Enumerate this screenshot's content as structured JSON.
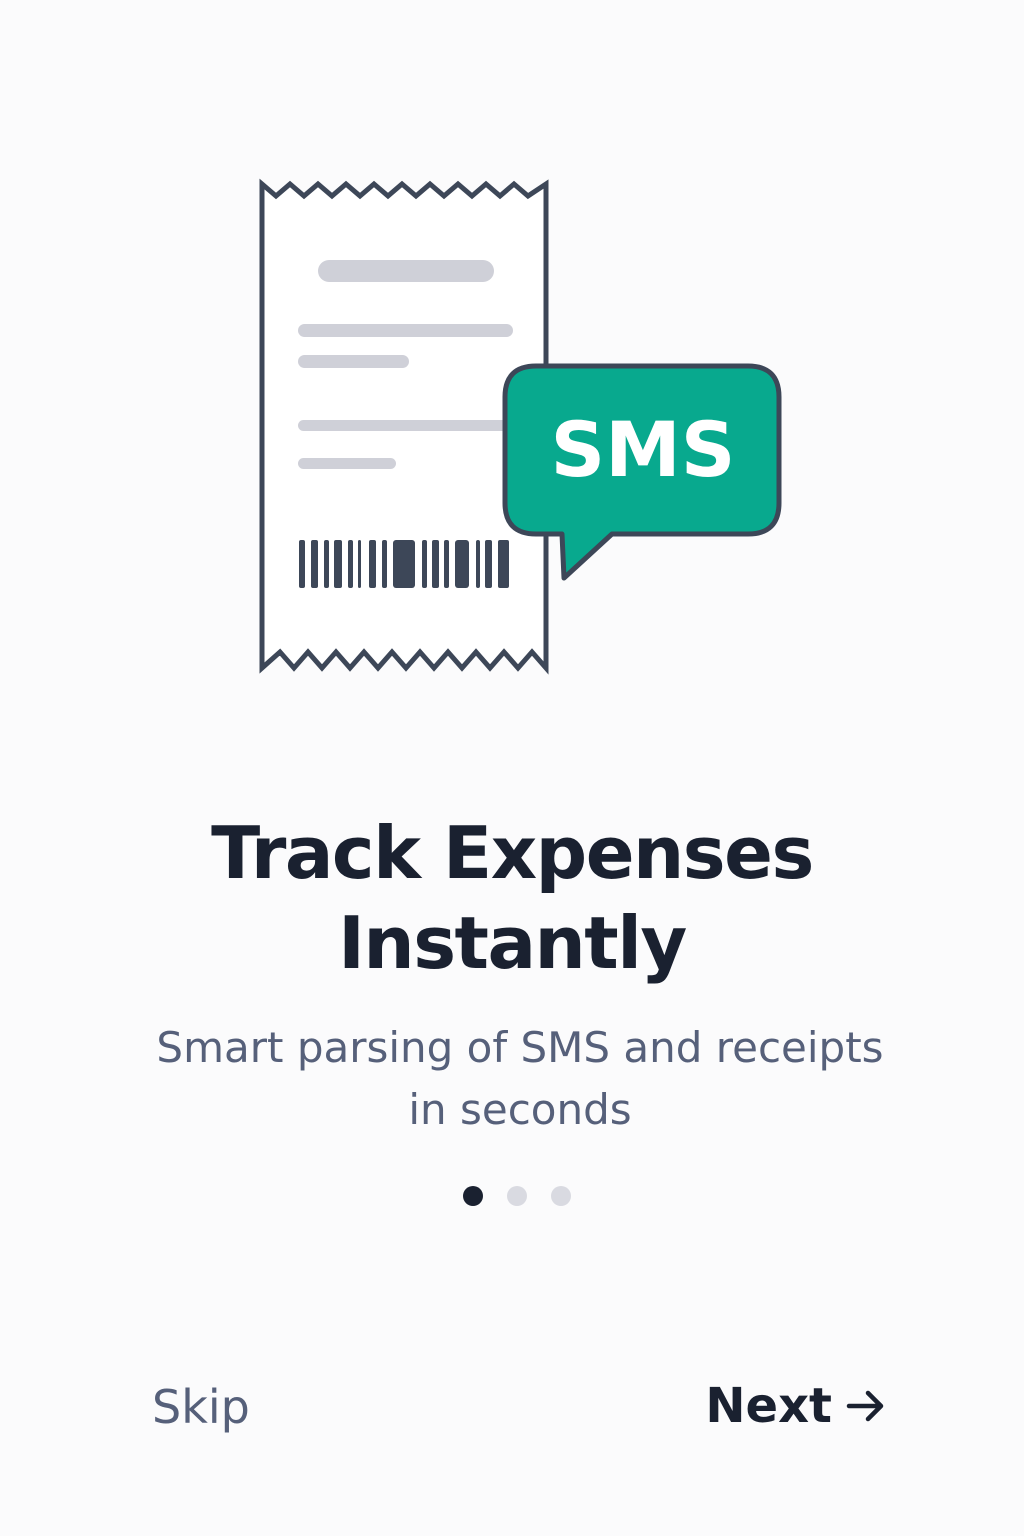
{
  "illustration": {
    "receipt_icon": "receipt-icon",
    "sms_bubble_icon": "sms-bubble-icon",
    "sms_label": "SMS",
    "colors": {
      "outline": "#3d4758",
      "placeholder_lines": "#cfd0d8",
      "bubble_fill": "#08a98e",
      "bubble_text": "#ffffff"
    }
  },
  "onboarding": {
    "title_line1": "Track Expenses",
    "title_line2": "Instantly",
    "subtitle_line1": "Smart parsing of SMS and receipts",
    "subtitle_line2": "in seconds",
    "page_indicator": {
      "current": 1,
      "total": 3
    }
  },
  "footer": {
    "skip_label": "Skip",
    "next_label": "Next",
    "next_icon": "arrow-right-icon"
  },
  "colors": {
    "background": "#fbfbfc",
    "text_primary": "#1a2130",
    "text_secondary": "#56607a",
    "dot_active": "#1a2130",
    "dot_inactive": "#d9dae1"
  }
}
